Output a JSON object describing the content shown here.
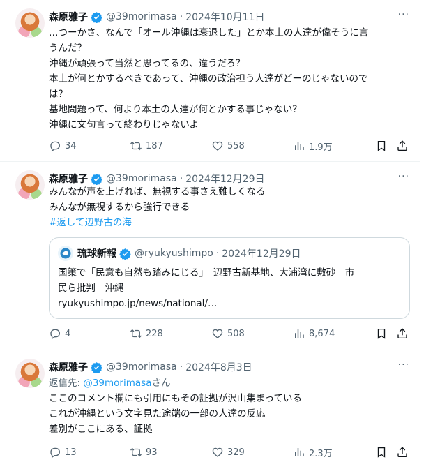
{
  "tweets": [
    {
      "name": "森原雅子",
      "handle": "@39morimasa",
      "sep": "·",
      "date": "2024年10月11日",
      "more": "···",
      "lines": [
        "…つーかさ、なんで「オール沖縄は衰退した」とか本土の人達が偉そうに言",
        "うんだ？",
        "沖縄が頑張って当然と思ってるの、違うだろ？",
        "本土が何とかするべきであって、沖縄の政治担う人達がどーのじゃないので",
        "は？",
        "基地問題って、何より本土の人達が何とかする事じゃない？",
        "沖縄に文句言って終わりじゃないよ"
      ],
      "replies": "34",
      "retweets": "187",
      "likes": "558",
      "views": "1.9万"
    },
    {
      "name": "森原雅子",
      "handle": "@39morimasa",
      "sep": "·",
      "date": "2024年12月29日",
      "more": "···",
      "lines": [
        "みんなが声を上げれば、無視する事さえ難しくなる",
        "みんなが無視するから強行できる"
      ],
      "hashtag": "#返して辺野古の海",
      "quote": {
        "name": "琉球新報",
        "handle": "@ryukyushimpo",
        "sep": "·",
        "date": "2024年12月29日",
        "lines": [
          "国策で「民意も自然も踏みにじる」　辺野古新基地、大浦湾に敷砂　市",
          "民ら批判　沖縄",
          "ryukyushimpo.jp/news/national/…"
        ]
      },
      "replies": "4",
      "retweets": "228",
      "likes": "508",
      "views": "8,674"
    },
    {
      "name": "森原雅子",
      "handle": "@39morimasa",
      "sep": "·",
      "date": "2024年8月3日",
      "more": "···",
      "reply_prefix": "返信先: ",
      "reply_handle": "@39morimasa",
      "reply_suffix": "さん",
      "lines": [
        "ここのコメント欄にも引用にもその証拠が沢山集まっている",
        "これが沖縄という文字見た途端の一部の人達の反応",
        "差別がここにある、証拠"
      ],
      "replies": "13",
      "retweets": "93",
      "likes": "329",
      "views": "2.3万"
    }
  ],
  "colors": {
    "accent": "#1d9bf0",
    "muted": "#536471",
    "text": "#0f1419",
    "border": "#eff3f4"
  },
  "icons": [
    "verified-badge-icon",
    "more-icon",
    "reply-icon",
    "retweet-icon",
    "like-icon",
    "views-icon",
    "bookmark-icon",
    "share-icon"
  ]
}
